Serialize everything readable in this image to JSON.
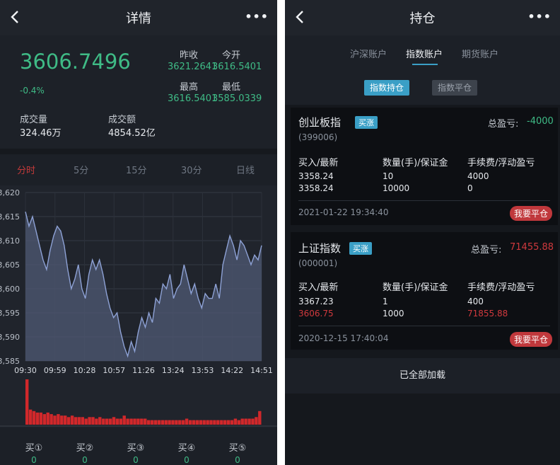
{
  "left": {
    "nav": {
      "title": "详情",
      "more": "•••"
    },
    "quote": {
      "price": "3606.7496",
      "change": "-0.4%",
      "prev_close_label": "昨收",
      "prev_close_value": "3621.2641",
      "open_label": "今开",
      "open_value": "3616.5401",
      "high_label": "最高",
      "high_value": "3616.5401",
      "low_label": "最低",
      "low_value": "3585.0339",
      "volume_label": "成交量",
      "volume_value": "324.46万",
      "turnover_label": "成交额",
      "turnover_value": "4854.52亿"
    },
    "period_tabs": [
      {
        "label": "分时",
        "active": true
      },
      {
        "label": "5分",
        "active": false
      },
      {
        "label": "15分",
        "active": false
      },
      {
        "label": "30分",
        "active": false
      },
      {
        "label": "日线",
        "active": false
      }
    ],
    "buy_levels": [
      {
        "label": "买①",
        "value": "0"
      },
      {
        "label": "买②",
        "value": "0"
      },
      {
        "label": "买③",
        "value": "0"
      },
      {
        "label": "买④",
        "value": "0"
      },
      {
        "label": "买⑤",
        "value": "0"
      }
    ]
  },
  "chart_data": {
    "type": "area",
    "y_ticks": [
      "3,620",
      "3,615",
      "3,610",
      "3,605",
      "3,600",
      "3,595",
      "3,590",
      "3,585"
    ],
    "ylim": [
      3585,
      3620
    ],
    "x_ticks": [
      "09:30",
      "09:59",
      "10:28",
      "10:57",
      "11:26",
      "13:24",
      "13:53",
      "14:22",
      "14:51"
    ],
    "series": [
      {
        "values": [
          3616,
          3613,
          3615,
          3612,
          3609,
          3606,
          3604,
          3608,
          3611,
          3613,
          3612,
          3609,
          3604,
          3600,
          3602,
          3605,
          3600,
          3598,
          3603,
          3606,
          3604,
          3606,
          3603,
          3599,
          3596,
          3594,
          3595,
          3591,
          3588,
          3586,
          3589,
          3587,
          3591,
          3594,
          3592,
          3595,
          3593,
          3598,
          3597,
          3601,
          3600,
          3603,
          3598,
          3600,
          3601,
          3605,
          3602,
          3599,
          3601,
          3598,
          3596,
          3599,
          3598,
          3598,
          3601,
          3598,
          3605,
          3608,
          3611,
          3609,
          3606,
          3610,
          3609,
          3607,
          3605,
          3607,
          3606,
          3609
        ]
      }
    ],
    "volume_values": [
      30,
      10,
      9,
      8,
      8,
      7,
      8,
      7,
      6,
      7,
      6,
      6,
      5,
      6,
      5,
      5,
      5,
      4,
      5,
      5,
      4,
      5,
      4,
      4,
      4,
      5,
      4,
      4,
      6,
      4,
      4,
      4,
      4,
      4,
      4,
      3,
      3,
      3,
      3,
      3,
      3,
      3,
      3,
      3,
      3,
      3,
      4,
      3,
      3,
      3,
      3,
      3,
      3,
      3,
      3,
      3,
      3,
      3,
      3,
      3,
      4,
      3,
      4,
      4,
      4,
      4,
      5,
      9
    ],
    "grid": true,
    "legend": "none"
  },
  "right": {
    "nav": {
      "title": "持仓",
      "more": "•••"
    },
    "account_tabs": [
      {
        "label": "沪深账户",
        "active": false
      },
      {
        "label": "指数账户",
        "active": true
      },
      {
        "label": "期货账户",
        "active": false
      }
    ],
    "sub_tabs": {
      "active": "指数持仓",
      "inactive": "指数平仓"
    },
    "columns": {
      "c1": "买入/最新",
      "c2": "数量(手)/保证金",
      "c3": "手续费/浮动盈亏"
    },
    "positions": [
      {
        "name": "创业板指",
        "badge": "买涨",
        "code": "(399006)",
        "pl_label": "总盈亏:",
        "pl_value": "-4000",
        "pl_color": "#3fbb86",
        "buy_price": "3358.24",
        "latest_price": "3358.24",
        "latest_red": false,
        "quantity": "10",
        "margin": "10000",
        "fee": "4000",
        "float_pl": "0",
        "float_red": false,
        "time": "2021-01-22 19:34:40",
        "close_label": "我要平仓"
      },
      {
        "name": "上证指数",
        "badge": "买涨",
        "code": "(000001)",
        "pl_label": "总盈亏:",
        "pl_value": "71455.88",
        "pl_color": "#d0393d",
        "buy_price": "3367.23",
        "latest_price": "3606.75",
        "latest_red": true,
        "quantity": "1",
        "margin": "1000",
        "fee": "400",
        "float_pl": "71855.88",
        "float_red": true,
        "time": "2020-12-15 17:40:04",
        "close_label": "我要平仓"
      }
    ],
    "loaded_text": "已全部加载"
  },
  "colors": {
    "up_red": "#d0393d",
    "down_green": "#3fbb86",
    "accent_blue": "#3a9fc6"
  },
  "icons": {
    "back": "chevron-left-icon",
    "more": "more-dots-icon"
  }
}
